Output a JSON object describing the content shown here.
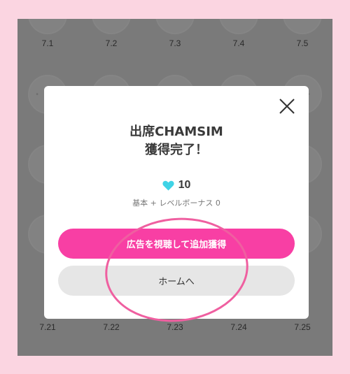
{
  "calendar": {
    "top_row": [
      "7.1",
      "7.2",
      "7.3",
      "7.4",
      "7.5"
    ],
    "bottom_row": [
      "7.21",
      "7.22",
      "7.23",
      "7.24",
      "7.25"
    ]
  },
  "modal": {
    "title_line1": "出席CHAMSIM",
    "title_line2": "獲得完了！",
    "reward_value": "10",
    "reward_note": "基本 + レベルボーナス 0",
    "primary_button": "広告を視聴して追加獲得",
    "secondary_button": "ホームへ"
  },
  "colors": {
    "background": "#fbd5e1",
    "overlay": "#7a7a7a",
    "primary": "#f83fa4",
    "heart": "#3fd3e6",
    "highlight_ring": "#ef5fa0"
  },
  "icons": {
    "close": "close-icon",
    "heart": "heart-icon"
  }
}
